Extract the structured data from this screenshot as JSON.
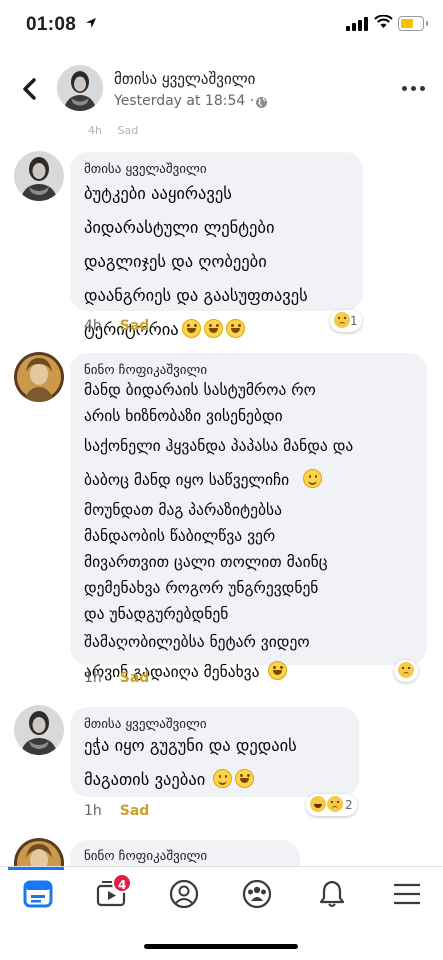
{
  "status_bar": {
    "time": "01:08"
  },
  "header": {
    "name": "მთისა ყველაშვილი",
    "subtitle": "Yesterday at 18:54 · "
  },
  "top_cutoff": {
    "time": "4h",
    "sad": "Sad"
  },
  "comments": [
    {
      "author": "მთისა ყველაშვილი",
      "lines": [
        "ბუტკები ააყირავეს",
        "პიდარასტული ლენტები",
        "დაგლიჯეს და ღობეები",
        "დაანგრიეს და გაასუფთავეს",
        "ტერიტორია"
      ],
      "emoji_name": "grinning-face-icon",
      "time": "4h",
      "reaction_label": "Sad",
      "reaction_count": "1"
    },
    {
      "author": "ნინო ჩოფიკაშვილი",
      "lines": [
        "მანდ ბიდარაის სასტუმროა რო",
        "არის ხიზნობაზი ვისენებდი",
        "საქონელი ჰყვანდა პაპასა მანდა და",
        "ბაბოც მანდ იყო საწველიჩი",
        "მოუნდათ მაგ პარაზიტებსა",
        "მანდაობის წაბილწვა ვერ",
        "მივართვით ცალი თოლით მაინც",
        "დემენახვა როგორ უნგრევდნენ",
        "და უნადგურებდნენ",
        "შამაღობილებსა  ნეტარ ვიდეო",
        "არვინ გადაიღა მენახვა"
      ],
      "time": "1h",
      "reaction_label": "Sad",
      "reaction_count": ""
    },
    {
      "author": "მთისა ყველაშვილი",
      "lines": [
        "ეჭა იყო გუგუნი და დედაის",
        "მაგათის ვაებაი"
      ],
      "time": "1h",
      "reaction_label": "Sad",
      "reaction_count": "2"
    },
    {
      "author": "ნინო ჩოფიკაშვილი"
    }
  ],
  "tabbar": {
    "video_badge": "4"
  }
}
